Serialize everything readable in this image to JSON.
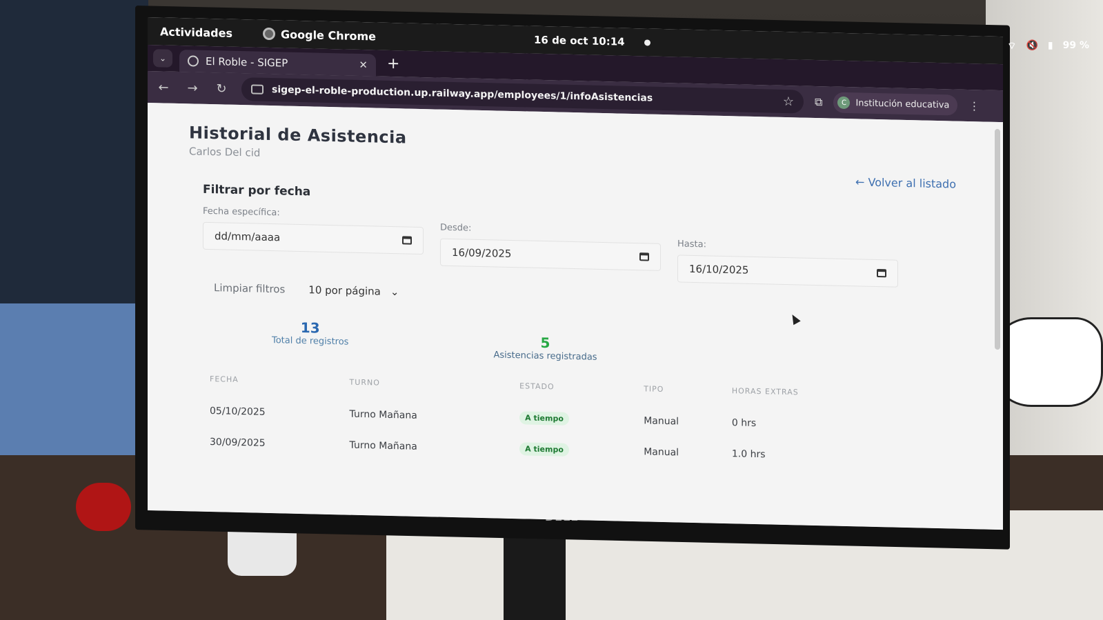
{
  "system": {
    "activities": "Actividades",
    "app_name": "Google Chrome",
    "clock": "16 de oct  10:14",
    "battery": "99 %"
  },
  "browser": {
    "tab_title": "El Roble - SIGEP",
    "tab_close": "✕",
    "new_tab": "+",
    "url": "sigep-el-roble-production.up.railway.app/employees/1/infoAsistencias",
    "profile_initial": "C",
    "profile_name": "Institución educativa",
    "window_close": "✕"
  },
  "page": {
    "title": "Historial de Asistencia",
    "employee_name": "Carlos Del cid",
    "back_link": "← Volver al listado",
    "filter_heading": "Filtrar por fecha",
    "filters": {
      "specific_label": "Fecha específica:",
      "specific_placeholder": "dd/mm/aaaa",
      "from_label": "Desde:",
      "from_value": "16/09/2025",
      "to_label": "Hasta:",
      "to_value": "16/10/2025",
      "clear_label": "Limpiar filtros",
      "per_page_value": "10 por página"
    },
    "stats": {
      "total_value": "13",
      "total_label": "Total de registros",
      "attendance_value": "5",
      "attendance_label": "Asistencias registradas"
    },
    "table": {
      "headers": [
        "FECHA",
        "TURNO",
        "ESTADO",
        "TIPO",
        "HORAS EXTRAS"
      ],
      "rows": [
        {
          "fecha": "05/10/2025",
          "turno": "Turno Mañana",
          "estado": "A tiempo",
          "tipo": "Manual",
          "horas": "0 hrs"
        },
        {
          "fecha": "30/09/2025",
          "turno": "Turno Mañana",
          "estado": "A tiempo",
          "tipo": "Manual",
          "horas": "1.0 hrs"
        }
      ]
    }
  },
  "monitor": {
    "brand": "DELL"
  },
  "colors": {
    "accent_blue": "#2a68b0",
    "accent_green": "#27a844",
    "browser_chrome": "#3a2d42"
  }
}
